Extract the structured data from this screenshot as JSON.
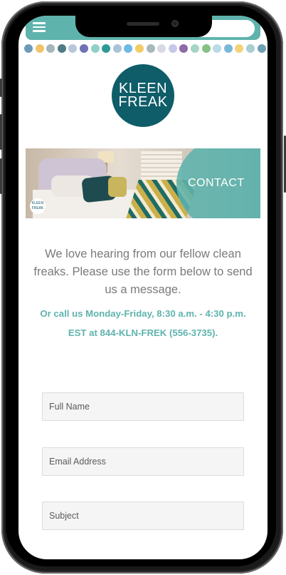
{
  "brand": {
    "logo_line1": "KLEEN",
    "logo_line2": "FREAK",
    "mini_logo_text": "KLEEN FREAK",
    "brand_color": "#0e5d69",
    "accent_color": "#5fb3ad"
  },
  "header": {
    "menu_icon": "hamburger-menu-icon"
  },
  "decor": {
    "dot_colors": [
      "#6c9bb8",
      "#f2c36a",
      "#a7b6b8",
      "#4e7c86",
      "#b7c8dc",
      "#6f72b4",
      "#8fd0c8",
      "#2e9a96",
      "#a9c3d6",
      "#6eb9e6",
      "#f4cc66",
      "#a7b9bb",
      "#d9d9e6",
      "#c6c8e8",
      "#8d6ba6",
      "#a6d4c5",
      "#86c186",
      "#b9dbe6",
      "#7bb8d8",
      "#f4d27a",
      "#a9cdd3",
      "#6ea0b4"
    ]
  },
  "banner": {
    "title": "CONTACT"
  },
  "content": {
    "intro_text": "We love hearing from our fellow clean freaks. Please use the form below to send us a message.",
    "callout_text": "Or call us Monday-Friday, 8:30 a.m. - 4:30 p.m. EST at 844-KLN-FREK (556-3735)."
  },
  "form": {
    "full_name_placeholder": "Full Name",
    "full_name_value": "",
    "email_placeholder": "Email Address",
    "email_value": "",
    "subject_placeholder": "Subject",
    "subject_value": ""
  }
}
